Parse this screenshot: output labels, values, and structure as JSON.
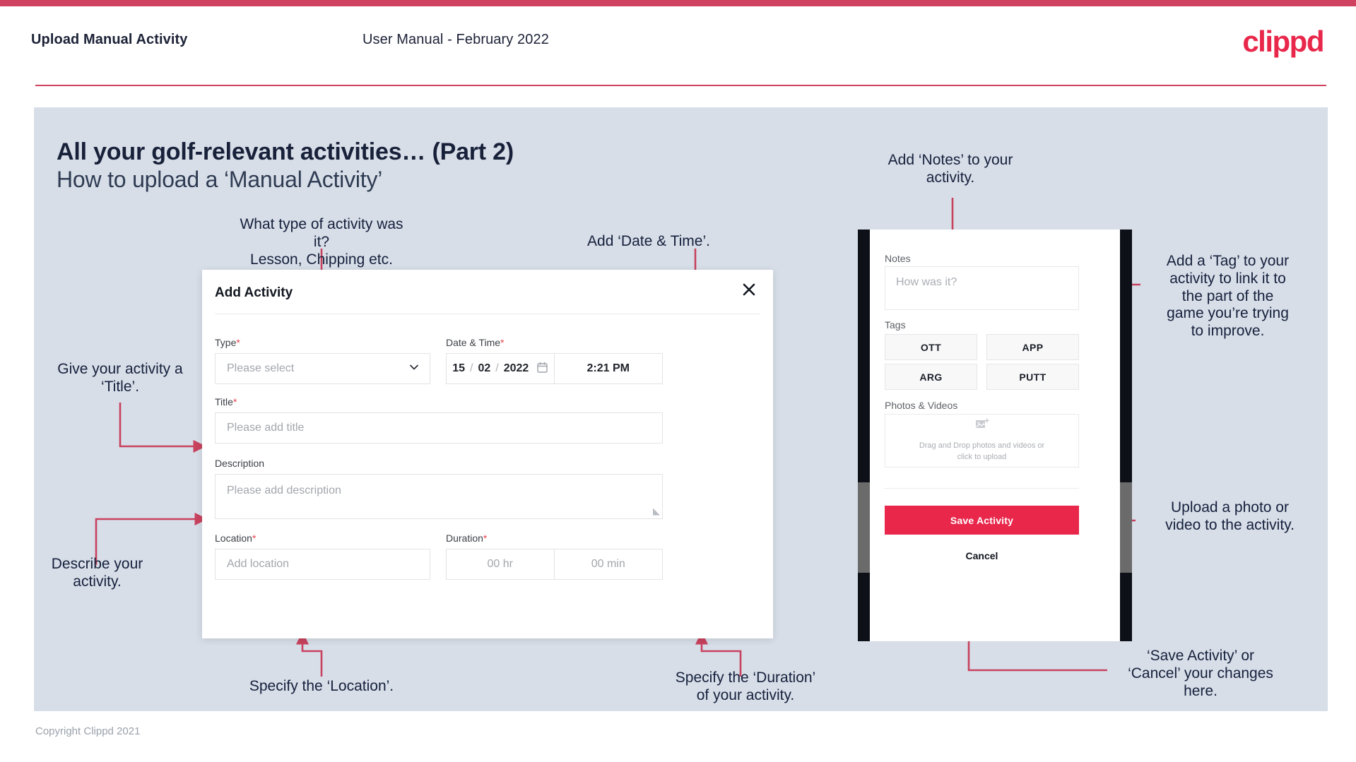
{
  "theme": {
    "accent": "#e8274b",
    "bar": "#cf4260",
    "slide_bg": "#d7dee8",
    "text_dark": "#15203c",
    "arrow": "#c8425e"
  },
  "header": {
    "left_title": "Upload Manual Activity",
    "center_title": "User Manual - February 2022",
    "logo": "clippd"
  },
  "slide": {
    "title_bold": "All your golf-relevant activities… (Part 2)",
    "title_regular": "How to upload a ‘Manual Activity’",
    "copyright": "Copyright Clippd 2021"
  },
  "annotations": {
    "type": "What type of activity was it?\nLesson, Chipping etc.",
    "datetime": "Add ‘Date & Time’.",
    "title": "Give your activity a\n‘Title’.",
    "description": "Describe your\nactivity.",
    "location": "Specify the ‘Location’.",
    "duration": "Specify the ‘Duration’\nof your activity.",
    "notes": "Add ‘Notes’ to your\nactivity.",
    "tags": "Add a ‘Tag’ to your\nactivity to link it to\nthe part of the\ngame you’re trying\nto improve.",
    "upload": "Upload a photo or\nvideo to the activity.",
    "save_cancel": "‘Save Activity’ or\n‘Cancel’ your changes\nhere."
  },
  "dialog": {
    "title": "Add Activity",
    "close_icon": "close-icon",
    "fields": {
      "type": {
        "label": "Type",
        "required": "*",
        "placeholder": "Please select",
        "caret_icon": "chevron-down-icon"
      },
      "datetime": {
        "label": "Date & Time",
        "required": "*",
        "day": "15",
        "month": "02",
        "year": "2022",
        "sep": "/",
        "calendar_icon": "calendar-icon",
        "time": "2:21 PM"
      },
      "title": {
        "label": "Title",
        "required": "*",
        "placeholder": "Please add title"
      },
      "description": {
        "label": "Description",
        "required": "",
        "placeholder": "Please add description"
      },
      "location": {
        "label": "Location",
        "required": "*",
        "placeholder": "Add location"
      },
      "duration": {
        "label": "Duration",
        "required": "*",
        "hours_placeholder": "00 hr",
        "minutes_placeholder": "00 min"
      }
    }
  },
  "phone": {
    "notes": {
      "label": "Notes",
      "placeholder": "How was it?"
    },
    "tags": {
      "label": "Tags",
      "items": [
        "OTT",
        "APP",
        "ARG",
        "PUTT"
      ]
    },
    "photos": {
      "label": "Photos & Videos",
      "icon": "add-image-icon",
      "dropzone_text": "Drag and Drop photos and videos or\nclick to upload"
    },
    "save_label": "Save Activity",
    "cancel_label": "Cancel"
  }
}
